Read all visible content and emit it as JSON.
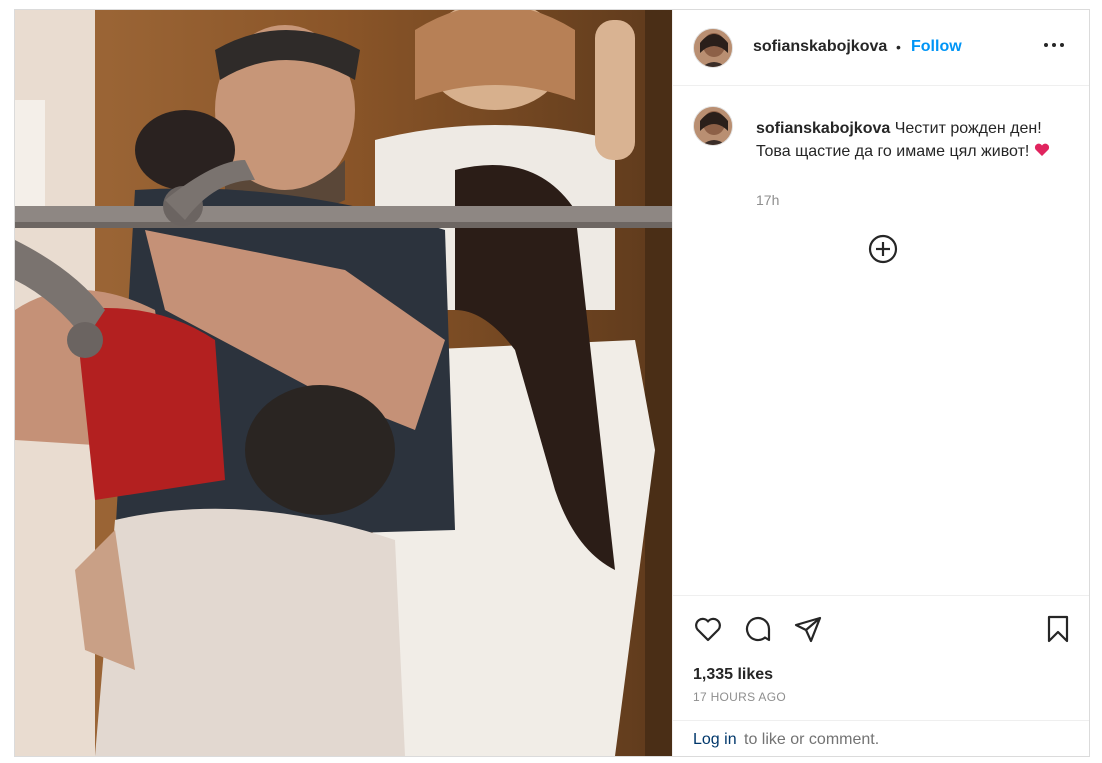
{
  "post": {
    "username": "sofianskabojkova",
    "separator": "•",
    "follow_label": "Follow",
    "caption_username": "sofianskabojkova",
    "caption_text": "Честит рожден ден! Това щастие да го имаме цял живот!",
    "caption_emoji_icon": "red-heart-icon",
    "time_ago": "17h",
    "likes": "1,335 likes",
    "date_label": "17 HOURS AGO",
    "login_link": "Log in",
    "login_suffix": "to like or comment."
  },
  "icons": {
    "more": "more-options-icon",
    "add_comment": "add-circle-icon",
    "like": "heart-icon",
    "comment": "comment-icon",
    "share": "share-icon",
    "save": "bookmark-icon"
  },
  "colors": {
    "follow": "#0095f6",
    "heart_emoji": "#e0245e",
    "text": "#262626",
    "muted": "#8e8e8e",
    "link": "#00376b"
  }
}
